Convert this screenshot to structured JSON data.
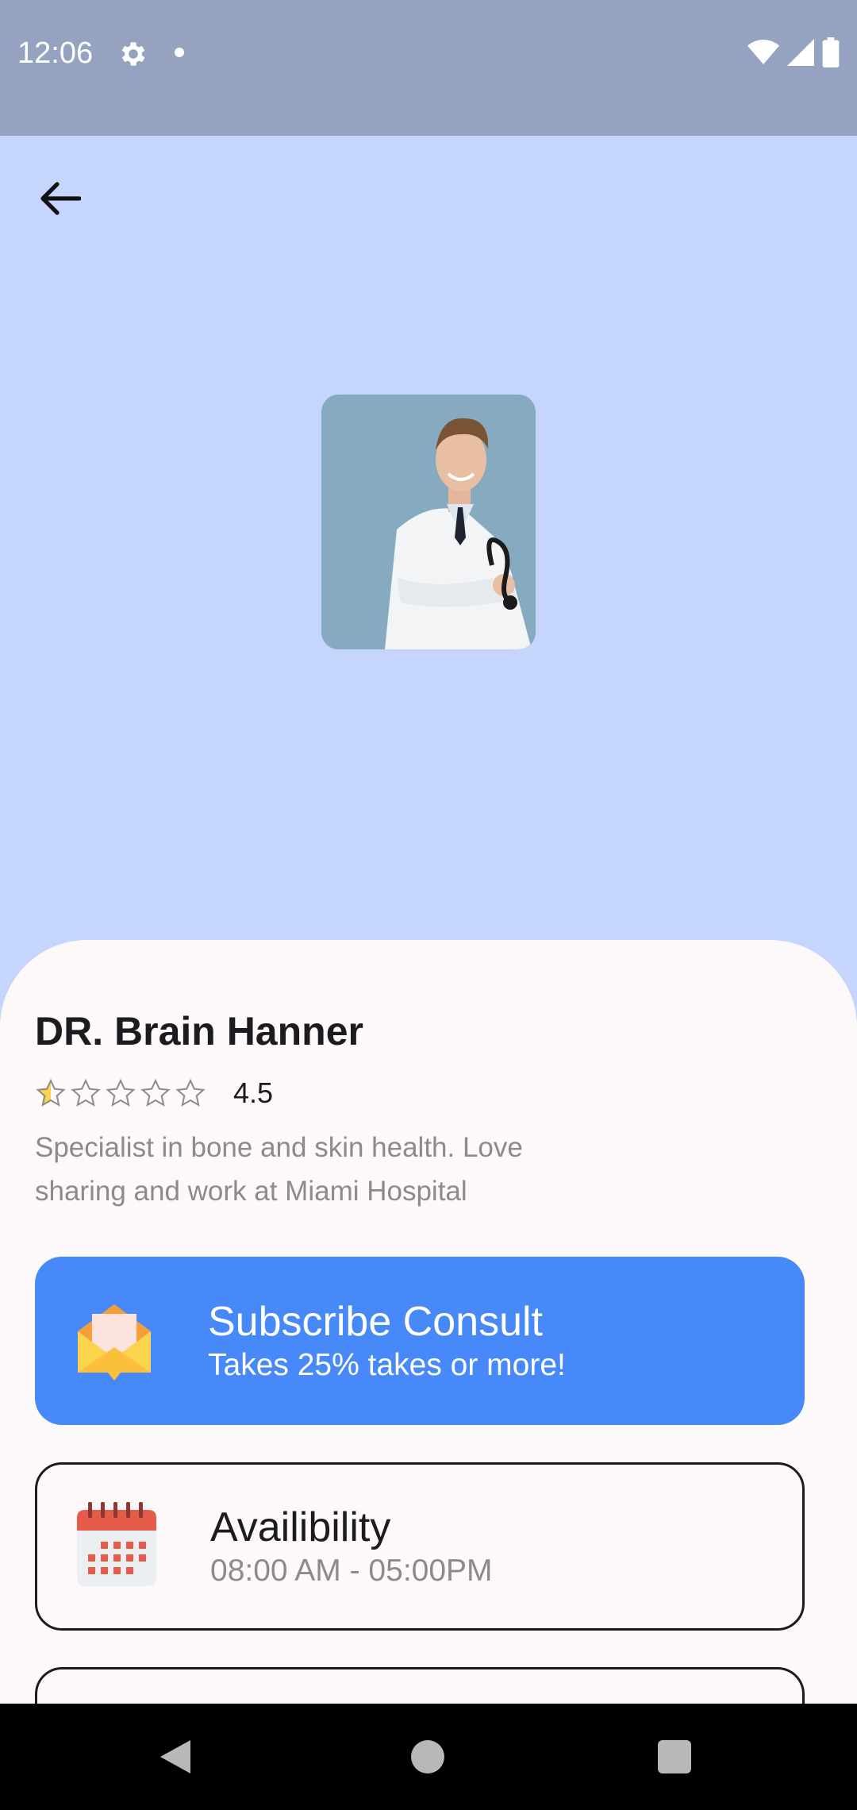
{
  "status_bar": {
    "time": "12:06",
    "icons": [
      "gear-icon",
      "notification-dot-icon",
      "wifi-icon",
      "signal-icon",
      "battery-icon"
    ]
  },
  "header": {
    "back_icon": "arrow-left-icon"
  },
  "doctor": {
    "name": "DR. Brain Hanner",
    "rating_value": "4.5",
    "rating_stars_filled": 0.5,
    "rating_stars_total": 5,
    "bio": "Specialist in bone and skin health. Love sharing and work at Miami Hospital"
  },
  "cards": {
    "subscribe": {
      "icon": "envelope-icon",
      "title": "Subscribe Consult",
      "subtitle": "Takes 25% takes or more!"
    },
    "availability": {
      "icon": "calendar-icon",
      "title": "Availibility",
      "subtitle": "08:00 AM - 05:00PM"
    }
  },
  "colors": {
    "hero_background": "#c5d5fe",
    "status_bar": "#95a3c0",
    "accent": "#4789f8",
    "sheet": "#fdf8f9",
    "star": "#fcd34d"
  },
  "nav_bar": {
    "icons": [
      "back-triangle-icon",
      "home-circle-icon",
      "recents-square-icon"
    ]
  }
}
